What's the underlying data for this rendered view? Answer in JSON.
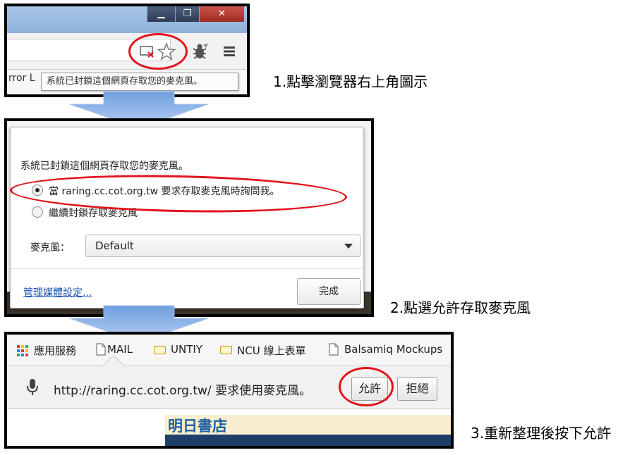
{
  "colors": {
    "highlight_ring": "#e3131b",
    "arrow_fill": "#8fb4e8",
    "link": "#1f56b5",
    "bookstore_title": "#1f5fa0"
  },
  "panel1": {
    "window_controls": {
      "minimize_glyph": "▁",
      "maximize_glyph": "❐",
      "close_glyph": "✕"
    },
    "toolbar_icons": [
      "camera-blocked-icon",
      "star-icon",
      "bug-extension-icon",
      "menu-icon"
    ],
    "bookmark_fragment": "rror L",
    "tooltip_text": "系統已封鎖這個網頁存取您的麥克風。"
  },
  "panel2": {
    "header_text": "系統已封鎖這個網頁存取您的麥克風。",
    "option_allow": "當 raring.cc.cot.org.tw 要求存取麥克風時詢問我。",
    "option_block": "繼續封鎖存取麥克風",
    "option_allow_selected": true,
    "microphone_label": "麥克風：",
    "microphone_value": "Default",
    "manage_link": "管理媒體設定...",
    "done_button": "完成"
  },
  "panel3": {
    "bookmarks": [
      {
        "label": "應用服務",
        "icon": "apps-grid-icon"
      },
      {
        "label": "MAIL",
        "icon": "page-icon"
      },
      {
        "label": "UNTIY",
        "icon": "folder-icon"
      },
      {
        "label": "NCU  線上表單",
        "icon": "folder-icon"
      },
      {
        "label": "Balsamiq Mockups",
        "icon": "page-icon"
      }
    ],
    "infobar_text": "http://raring.cc.cot.org.tw/ 要求使用麥克風。",
    "allow_button": "允許",
    "deny_button": "拒絕",
    "page_heading": "明日書店"
  },
  "instructions": {
    "step1": "1.點擊瀏覽器右上角圖示",
    "step2": "2.點選允許存取麥克風",
    "step3": "3.重新整理後按下允許"
  }
}
